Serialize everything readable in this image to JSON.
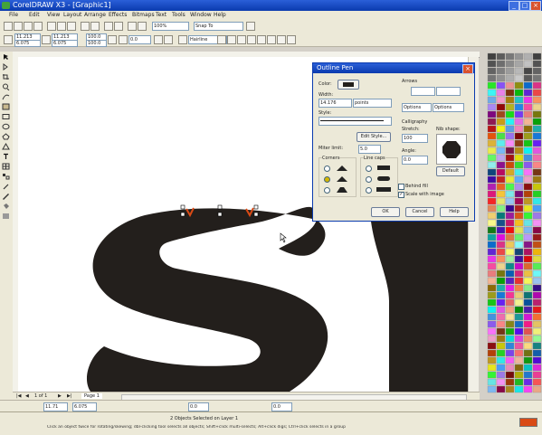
{
  "app": {
    "title": "CorelDRAW X3 - [Graphic1]",
    "window_controls": {
      "minimize": "_",
      "maximize": "□",
      "close": "×"
    }
  },
  "menu": {
    "items": [
      "File",
      "Edit",
      "View",
      "Layout",
      "Arrange",
      "Effects",
      "Bitmaps",
      "Text",
      "Tools",
      "Window",
      "Help"
    ]
  },
  "standard_toolbar": {
    "zoom_value": "100%",
    "snap_label": "Snap To"
  },
  "property_bar": {
    "x": "11.213",
    "y": "6.075",
    "w": "100.0",
    "h": "100.0",
    "angle": "0.0",
    "outline_width": "Hairline"
  },
  "dialog": {
    "title": "Outline Pen",
    "close": "×",
    "color_label": "Color:",
    "width_label": "Width:",
    "width_value": "14.176",
    "width_unit": "points",
    "style_label": "Style:",
    "edit_style_button": "Edit Style...",
    "miter_label": "Miter limit:",
    "miter_value": "5.0",
    "corners_label": "Corners",
    "line_caps_label": "Line caps",
    "arrows_label": "Arrows",
    "arrow_options_left": "Options",
    "arrow_options_right": "Options",
    "calligraphy_label": "Calligraphy",
    "stretch_label": "Stretch:",
    "stretch_value": "100",
    "angle_label": "Angle:",
    "angle_value": "0.0",
    "nib_shape_label": "Nib shape:",
    "default_button": "Default",
    "behind_fill_label": "Behind fill",
    "scale_with_image_label": "Scale with image",
    "ok_button": "OK",
    "cancel_button": "Cancel",
    "help_button": "Help",
    "accent": "#0a3aae"
  },
  "canvas": {
    "glyphs": "ST",
    "glyph_color": "#231f1c",
    "node_color": "#d94a15"
  },
  "page_nav": {
    "page_counter": "1 of 1",
    "page_tab": "Page 1"
  },
  "bottom_bar": {
    "x": "11.71",
    "y": "6.075",
    "size": "0.0"
  },
  "status": {
    "selection": "2 Objects Selected on Layer 1",
    "hint": "Click an object twice for rotating/skewing; dbl-clicking tool selects all objects; Shift+click multi-selects; Alt+click digs; Ctrl+click selects in a group"
  }
}
